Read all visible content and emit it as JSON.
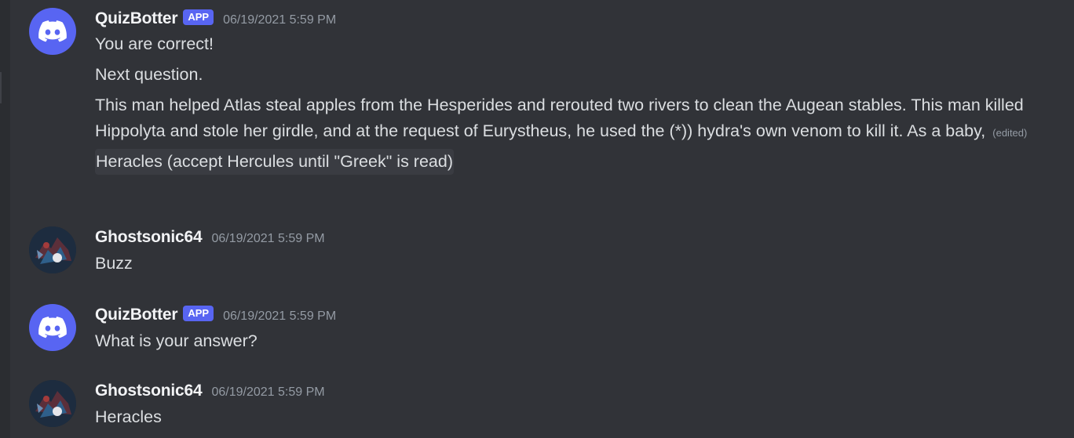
{
  "messages": [
    {
      "username": "QuizBotter",
      "badge": "APP",
      "timestamp": "06/19/2021 5:59 PM",
      "avatar_icon": "discord-logo-icon",
      "lines": [
        "You are correct!",
        "Next question.",
        "This man helped Atlas steal apples from the Hesperides and rerouted two rivers to clean the Augean stables. This man killed Hippolyta and stole her girdle, and at the request of Eurystheus, he used the (*)) hydra's own venom to kill it. As a baby,"
      ],
      "edited_label": "(edited)",
      "answer": "Heracles (accept Hercules until \"Greek\" is read)"
    },
    {
      "username": "Ghostsonic64",
      "timestamp": "06/19/2021 5:59 PM",
      "avatar_icon": "user-avatar",
      "lines": [
        "Buzz"
      ]
    },
    {
      "username": "QuizBotter",
      "badge": "APP",
      "timestamp": "06/19/2021 5:59 PM",
      "avatar_icon": "discord-logo-icon",
      "lines": [
        "What is your answer?"
      ]
    },
    {
      "username": "Ghostsonic64",
      "timestamp": "06/19/2021 5:59 PM",
      "avatar_icon": "user-avatar",
      "lines": [
        "Heracles"
      ]
    }
  ],
  "colors": {
    "background": "#313338",
    "bot_avatar": "#5865f2",
    "app_badge": "#5865f2",
    "username": "#f2f3f5",
    "text": "#dbdee1",
    "muted": "#949ba4"
  }
}
